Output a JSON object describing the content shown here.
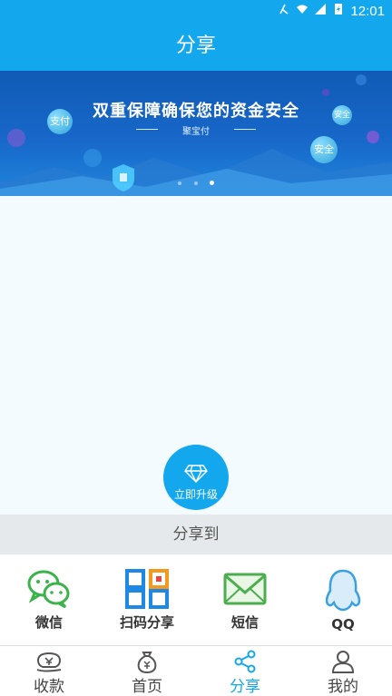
{
  "status_bar": {
    "time": "12:01"
  },
  "header": {
    "title": "分享"
  },
  "banner": {
    "headline": "双重保障确保您的资金安全",
    "brand": "聚宝付",
    "bubbles": [
      "支付",
      "安全",
      "安全"
    ],
    "active_page": 3,
    "page_count": 3
  },
  "upgrade": {
    "label": "立即升级"
  },
  "share_section": {
    "title": "分享到",
    "items": [
      {
        "label": "微信",
        "icon": "wechat-icon"
      },
      {
        "label": "扫码分享",
        "icon": "qrcode-icon"
      },
      {
        "label": "短信",
        "icon": "sms-icon"
      },
      {
        "label": "QQ",
        "icon": "qq-icon"
      }
    ]
  },
  "tabs": [
    {
      "label": "收款",
      "icon": "receive-money-icon"
    },
    {
      "label": "首页",
      "icon": "money-bag-icon"
    },
    {
      "label": "分享",
      "icon": "share-icon",
      "active": true
    },
    {
      "label": "我的",
      "icon": "user-icon"
    }
  ],
  "colors": {
    "primary": "#13a8ee",
    "tab_active": "#13a8ee",
    "share_bg": "#e6e9ec"
  }
}
